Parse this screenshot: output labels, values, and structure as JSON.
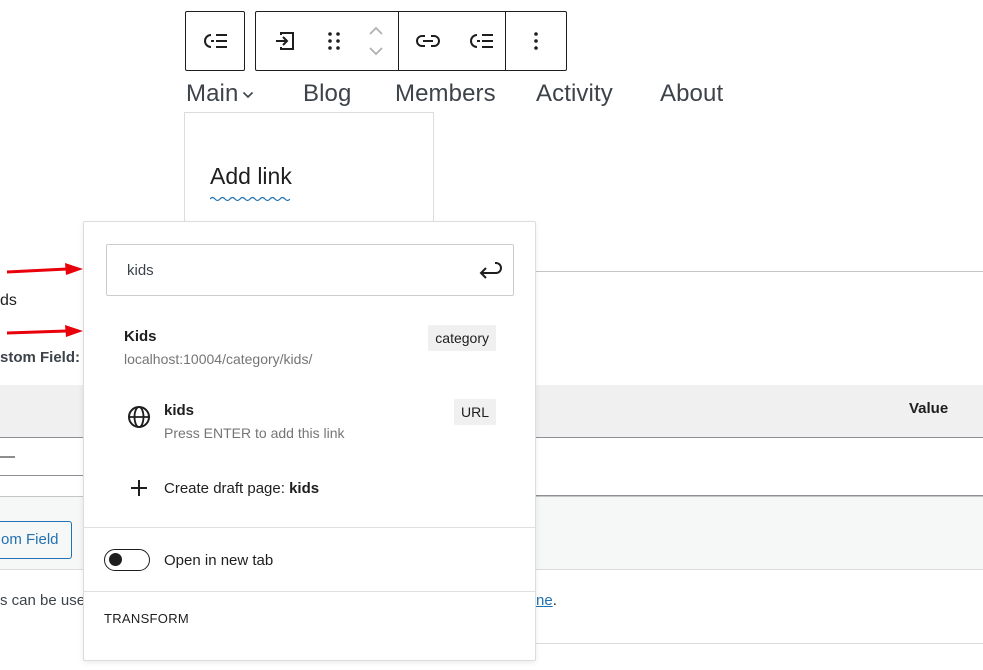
{
  "toolbar": {
    "groups": [
      {
        "buttons": [
          "list-view-icon"
        ]
      },
      {
        "buttons": [
          "submenu-icon",
          "drag-handle-icon",
          "move-up-down-icon"
        ]
      },
      {
        "buttons": [
          "link-icon",
          "add-submenu-icon"
        ]
      },
      {
        "buttons": [
          "more-options-icon"
        ]
      }
    ]
  },
  "nav": {
    "items": [
      "Main",
      "Blog",
      "Members",
      "Activity",
      "About"
    ]
  },
  "submenu": {
    "add_link_label": "Add link"
  },
  "background": {
    "ds_fragment": "ds",
    "custom_field_label": "stom Field:",
    "table_value_header": "Value",
    "dash": "—",
    "add_custom_field_button": "om Field",
    "footer_text_prefix": "s can be use",
    "footer_link_fragment": "ne",
    "footer_period": "."
  },
  "popover": {
    "search": {
      "value": "kids",
      "submit_icon": "enter-icon"
    },
    "results": [
      {
        "title": "Kids",
        "subtitle": "localhost:10004/category/kids/",
        "badge": "category"
      },
      {
        "title": "kids",
        "subtitle": "Press ENTER to add this link",
        "badge": "URL",
        "icon": "globe-icon"
      }
    ],
    "create_draft": {
      "prefix": "Create draft page:",
      "name": "kids",
      "icon": "plus-icon"
    },
    "new_tab": {
      "label": "Open in new tab",
      "enabled": false
    },
    "transform_label": "TRANSFORM"
  },
  "colors": {
    "annotation_arrow": "#e8000b",
    "link": "#2271b1",
    "text": "#1e1e1e"
  }
}
